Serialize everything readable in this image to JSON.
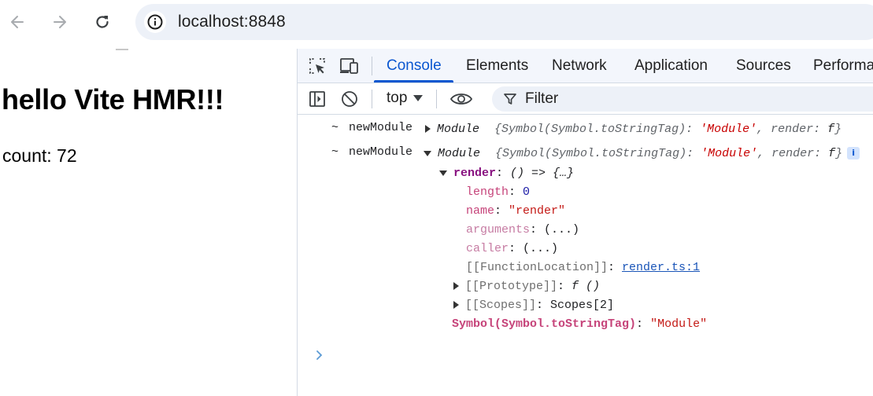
{
  "browser": {
    "url": "localhost:8848",
    "icons": {
      "back": "arrow-left-icon",
      "forward": "arrow-right-icon",
      "reload": "reload-icon",
      "site_info": "info-circle-icon"
    }
  },
  "page": {
    "heading": "hello Vite HMR!!!",
    "count": "count: 72"
  },
  "devtools": {
    "tabs": [
      "Console",
      "Elements",
      "Network",
      "Application",
      "Sources",
      "Performa"
    ],
    "active_tab": "Console",
    "toolbar": {
      "context": "top",
      "filter_placeholder": "Filter"
    },
    "console": {
      "entries": [
        {
          "tilde": "~",
          "label": "newModule",
          "type": "Module",
          "preview_open": "{Symbol(Symbol.toStringTag): ",
          "preview_tag": "'Module'",
          "preview_mid": ", render: ",
          "preview_fn": "f",
          "preview_close": "}"
        },
        {
          "tilde": "~",
          "label": "newModule",
          "type": "Module",
          "preview_open": "{Symbol(Symbol.toStringTag): ",
          "preview_tag": "'Module'",
          "preview_mid": ", render: ",
          "preview_fn": "f",
          "preview_close": "}",
          "badge": "i"
        }
      ],
      "render": {
        "key": "render",
        "value": "() => {…}",
        "props": {
          "length_key": "length",
          "length_value": "0",
          "name_key": "name",
          "name_value": "\"render\"",
          "arguments_key": "arguments",
          "arguments_value": "(...)",
          "caller_key": "caller",
          "caller_value": "(...)",
          "location_key": "[[FunctionLocation]]",
          "location_value": "render.ts:1",
          "prototype_key": "[[Prototype]]",
          "prototype_value": "f ()",
          "scopes_key": "[[Scopes]]",
          "scopes_value": "Scopes[2]"
        }
      },
      "symbol_key": "Symbol(Symbol.toStringTag)",
      "symbol_value": "\"Module\"",
      "prompt": "›"
    }
  },
  "colors": {
    "accent": "#0b57d0",
    "omnibox_bg": "#edf1f8",
    "devtools_bar_bg": "#f3f6fc",
    "string_red": "#c80000",
    "key_purple": "#881280"
  }
}
